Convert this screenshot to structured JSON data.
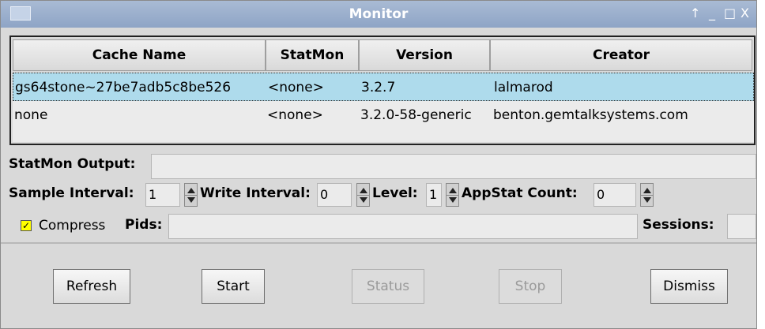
{
  "window": {
    "title": "Monitor",
    "controls": [
      "↑",
      "_",
      "□",
      "X"
    ]
  },
  "table": {
    "headers": [
      "Cache Name",
      "StatMon",
      "Version",
      "Creator"
    ],
    "rows": [
      {
        "cache_name": "gs64stone~27be7adb5c8be526",
        "statmon": "<none>",
        "version": "3.2.7",
        "creator": "lalmarod",
        "selected": true
      },
      {
        "cache_name": "none",
        "statmon": "<none>",
        "version": "3.2.0-58-generic",
        "creator": "benton.gemtalksystems.com",
        "selected": false
      }
    ]
  },
  "form": {
    "statmon_output_label": "StatMon Output:",
    "statmon_output_value": "",
    "sample_interval_label": "Sample Interval:",
    "sample_interval_value": "1",
    "write_interval_label": "Write Interval:",
    "write_interval_value": "0",
    "level_label": "Level:",
    "level_value": "1",
    "appstat_count_label": "AppStat Count:",
    "appstat_count_value": "0",
    "compress_label": "Compress",
    "compress_checked": true,
    "pids_label": "Pids:",
    "pids_value": "",
    "sessions_label": "Sessions:",
    "sessions_value": ""
  },
  "buttons": {
    "refresh": "Refresh",
    "start": "Start",
    "status": "Status",
    "stop": "Stop",
    "dismiss": "Dismiss"
  },
  "colors": {
    "selected_row": "#aedbec",
    "titlebar": "#9db0cd",
    "checkbox": "#ffff00"
  }
}
